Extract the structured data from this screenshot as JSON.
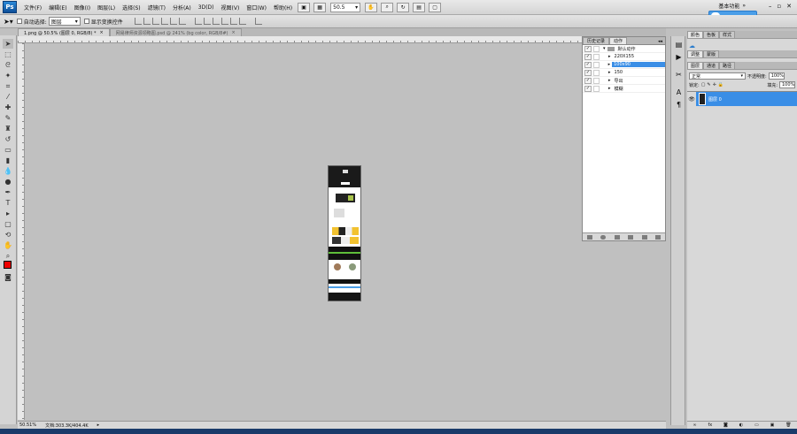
{
  "app": {
    "logo": "Ps"
  },
  "menu": [
    "文件(F)",
    "编辑(E)",
    "图像(I)",
    "图层(L)",
    "选择(S)",
    "滤镜(T)",
    "分析(A)",
    "3D(D)",
    "视图(V)",
    "窗口(W)",
    "帮助(H)"
  ],
  "toolbar_menu": {
    "zoom_value": "50.5",
    "workspace": "基本功能"
  },
  "options": {
    "auto_select_label": "自动选择:",
    "auto_select_value": "图层",
    "show_transform_label": "显示变换控件"
  },
  "tabs": [
    {
      "label": "1.png @ 50.5% (图层 0, RGB/8) *"
    },
    {
      "label": "网易律师资源领略图.psd @ 241% (bg color, RGB/8#)"
    }
  ],
  "status": {
    "zoom": "50.51%",
    "doc": "文档:303.3K/404.4K"
  },
  "actions_panel": {
    "tabs": [
      "历史记录",
      "动作"
    ],
    "rows": [
      {
        "label": "默认动作",
        "folder": true
      },
      {
        "label": "220X155"
      },
      {
        "label": "100x90",
        "selected": true
      },
      {
        "label": "150"
      },
      {
        "label": "导出"
      },
      {
        "label": "模糊"
      }
    ]
  },
  "right_panels": {
    "group1_tabs": [
      "颜色",
      "色板",
      "样式"
    ],
    "group2_tabs": [
      "调整",
      "蒙版"
    ],
    "group3_tabs": [
      "图层",
      "通道",
      "路径"
    ],
    "blend_mode": "正常",
    "opacity_label": "不透明度:",
    "opacity_value": "100%",
    "lock_label": "锁定:",
    "fill_label": "填充:",
    "fill_value": "100%",
    "layer_name": "图层 0"
  },
  "colors": {
    "foreground": "#e00000",
    "selection": "#3a8ee6"
  }
}
